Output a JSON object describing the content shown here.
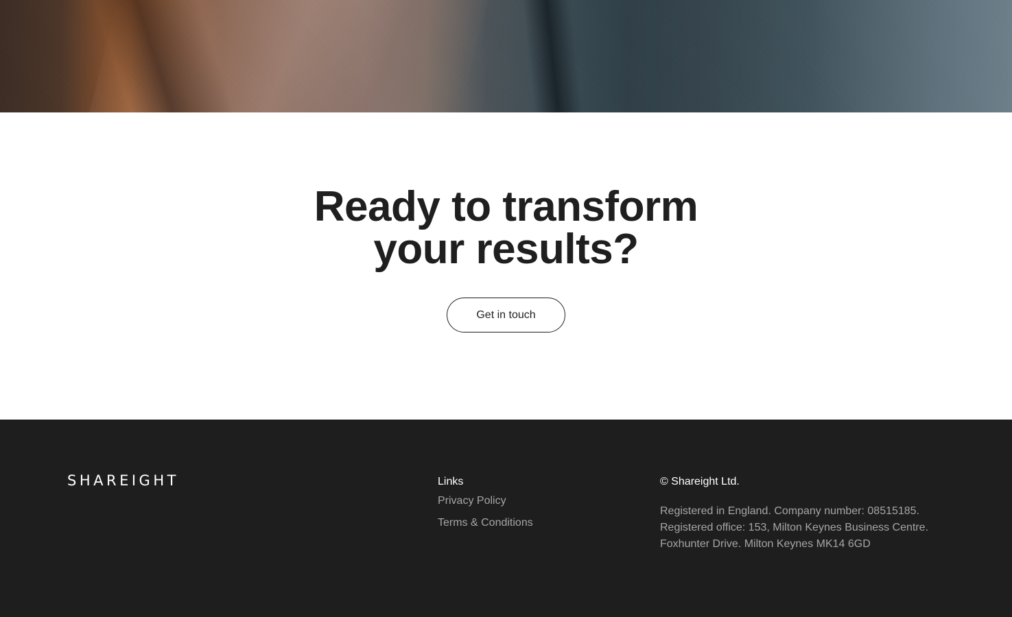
{
  "hero": {
    "image_description_icon": "photo-person-shirt"
  },
  "cta": {
    "title_line1": "Ready to transform",
    "title_line2": "your results?",
    "button_label": "Get in touch"
  },
  "footer": {
    "logo_text": "SHAREIGHT",
    "links_heading": "Links",
    "links": [
      {
        "label": "Privacy Policy"
      },
      {
        "label": "Terms & Conditions"
      }
    ],
    "copyright": "© Shareight Ltd.",
    "address_lines": [
      "Registered in England. Company number: 08515185.",
      "Registered office: 153, Milton Keynes Business Centre.",
      "Foxhunter Drive. Milton Keynes MK14 6GD"
    ]
  },
  "colors": {
    "footer_bg": "#1e1e1e",
    "text_dark": "#1f1f1f",
    "footer_muted": "#a6a6a6"
  }
}
